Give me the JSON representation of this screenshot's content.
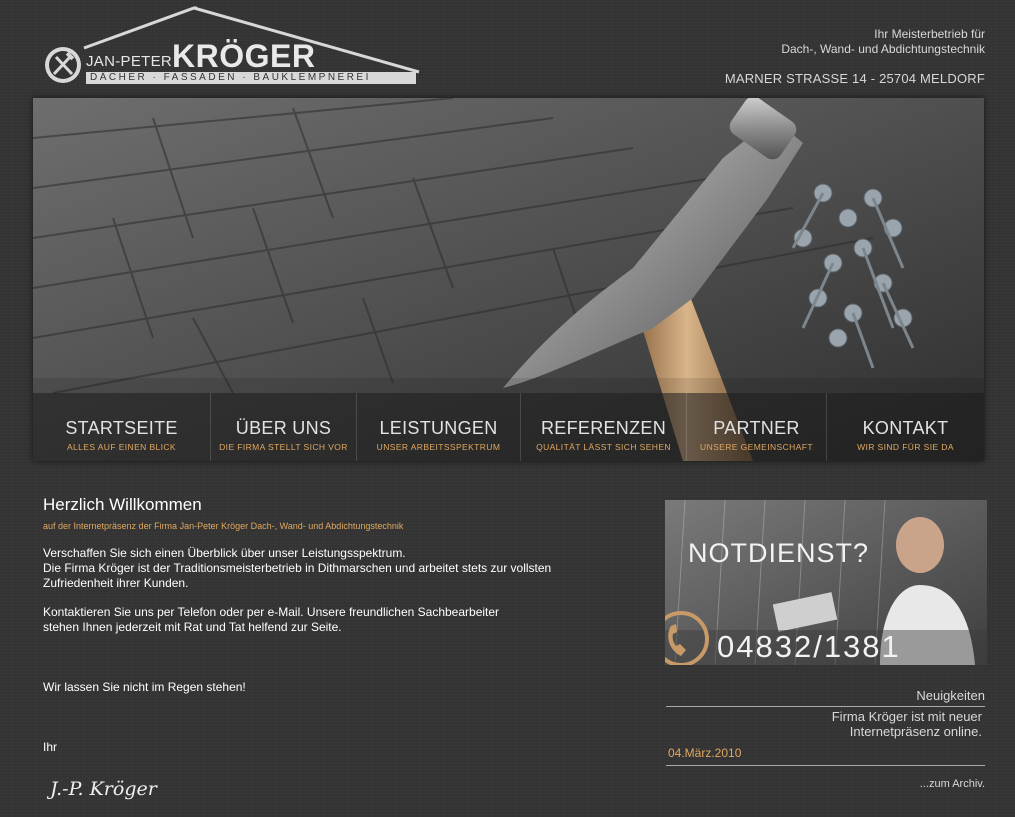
{
  "colors": {
    "background": "#333333",
    "accent": "#e0a860",
    "text": "#ffffff"
  },
  "header": {
    "logo": {
      "first_name": "JAN-PETER",
      "last_name": "KRÖGER",
      "subtitle": "DÄCHER · FASSADEN · BAUKLEMPNEREI",
      "emblem_icon": "roofer-guild-emblem-icon"
    },
    "tagline_line1": "Ihr Meisterbetrieb für",
    "tagline_line2": "Dach-, Wand- und Abdichtungstechnik",
    "address": "MARNER STRASSE 14 - 25704 MELDORF"
  },
  "nav": [
    {
      "title": "STARTSEITE",
      "subtitle": "ALLES AUF EINEN BLICK"
    },
    {
      "title": "ÜBER UNS",
      "subtitle": "DIE FIRMA STELLT SICH VOR"
    },
    {
      "title": "LEISTUNGEN",
      "subtitle": "UNSER ARBEITSSPEKTRUM"
    },
    {
      "title": "REFERENZEN",
      "subtitle": "QUALITÄT LÄSST SICH SEHEN"
    },
    {
      "title": "PARTNER",
      "subtitle": "UNSERE GEMEINSCHAFT"
    },
    {
      "title": "KONTAKT",
      "subtitle": "WIR SIND FÜR SIE DA"
    }
  ],
  "main": {
    "title": "Herzlich Willkommen",
    "subtitle": "auf der Internetpräsenz der Firma Jan-Peter Kröger Dach-, Wand- und Abdichtungstechnik",
    "para1_line1": "Verschaffen Sie sich einen Überblick über unser Leistungsspektrum.",
    "para1_line2": "Die Firma Kröger ist der Traditionsmeisterbetrieb in Dithmarschen und arbeitet stets zur vollsten Zufriedenheit ihrer Kunden.",
    "para2_line1": "Kontaktieren Sie uns per Telefon oder per e-Mail. Unsere freundlichen Sachbearbeiter",
    "para2_line2": "stehen Ihnen jederzeit mit Rat und Tat helfend zur Seite.",
    "para3": "Wir lassen Sie nicht im Regen stehen!",
    "closing": "Ihr",
    "signature": "J.-P. Kröger"
  },
  "sidebar": {
    "notdienst_title": "NOTDIENST?",
    "notdienst_phone": "04832/1381",
    "phone_icon": "telephone-handset-icon",
    "news_title": "Neuigkeiten",
    "news_text_line1": "Firma Kröger ist mit neuer",
    "news_text_line2": "Internetpräsenz online.",
    "news_date": "04.März.2010",
    "news_archive": "...zum Archiv."
  }
}
